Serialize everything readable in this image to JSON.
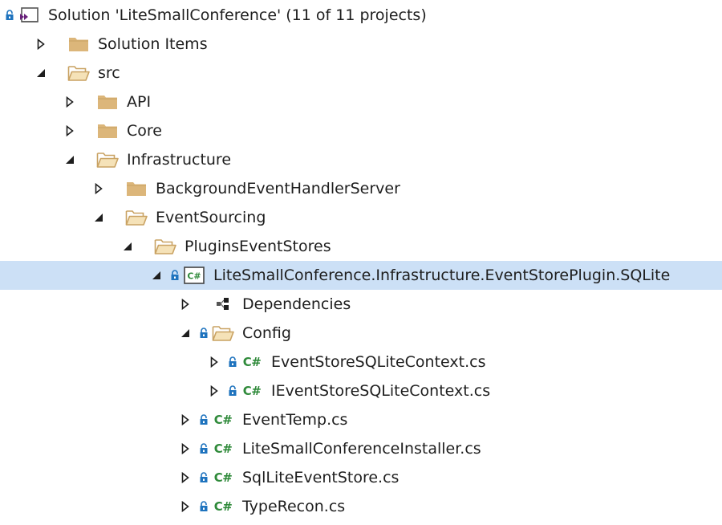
{
  "tree": [
    {
      "name": "solution-node",
      "label": "Solution 'LiteSmallConference' (11 of 11 projects)",
      "indent": 0,
      "expander": "none",
      "icon": "solution-icon",
      "lock": true
    },
    {
      "name": "folder-solution-items",
      "label": "Solution Items",
      "indent": 1,
      "expander": "collapsed",
      "icon": "folder-closed-icon",
      "lock": false
    },
    {
      "name": "folder-src",
      "label": "src",
      "indent": 1,
      "expander": "expanded",
      "icon": "folder-open-icon",
      "lock": false
    },
    {
      "name": "folder-api",
      "label": "API",
      "indent": 2,
      "expander": "collapsed",
      "icon": "folder-closed-icon",
      "lock": false
    },
    {
      "name": "folder-core",
      "label": "Core",
      "indent": 2,
      "expander": "collapsed",
      "icon": "folder-closed-icon",
      "lock": false
    },
    {
      "name": "folder-infrastructure",
      "label": "Infrastructure",
      "indent": 2,
      "expander": "expanded",
      "icon": "folder-open-icon",
      "lock": false
    },
    {
      "name": "folder-background-event-handler-server",
      "label": "BackgroundEventHandlerServer",
      "indent": 3,
      "expander": "collapsed",
      "icon": "folder-closed-icon",
      "lock": false
    },
    {
      "name": "folder-event-sourcing",
      "label": "EventSourcing",
      "indent": 3,
      "expander": "expanded",
      "icon": "folder-open-icon",
      "lock": false
    },
    {
      "name": "folder-plugins-event-stores",
      "label": "PluginsEventStores",
      "indent": 4,
      "expander": "expanded",
      "icon": "folder-open-icon",
      "lock": false
    },
    {
      "name": "project-event-store-plugin-sqlite",
      "label": "LiteSmallConference.Infrastructure.EventStorePlugin.SQLite",
      "indent": 5,
      "expander": "expanded",
      "icon": "csharp-project-icon",
      "lock": true,
      "selected": true
    },
    {
      "name": "node-dependencies",
      "label": "Dependencies",
      "indent": 6,
      "expander": "collapsed",
      "icon": "dependencies-icon",
      "lock": false
    },
    {
      "name": "folder-config",
      "label": "Config",
      "indent": 6,
      "expander": "expanded",
      "icon": "folder-open-icon",
      "lock": true
    },
    {
      "name": "file-event-store-sqlite-context",
      "label": "EventStoreSQLiteContext.cs",
      "indent": 7,
      "expander": "collapsed",
      "icon": "csharp-file-icon",
      "lock": true
    },
    {
      "name": "file-ievent-store-sqlite-context",
      "label": "IEventStoreSQLiteContext.cs",
      "indent": 7,
      "expander": "collapsed",
      "icon": "csharp-file-icon",
      "lock": true
    },
    {
      "name": "file-event-temp",
      "label": "EventTemp.cs",
      "indent": 6,
      "expander": "collapsed",
      "icon": "csharp-file-icon",
      "lock": true
    },
    {
      "name": "file-lite-small-conference-installer",
      "label": "LiteSmallConferenceInstaller.cs",
      "indent": 6,
      "expander": "collapsed",
      "icon": "csharp-file-icon",
      "lock": true
    },
    {
      "name": "file-sql-lite-event-store",
      "label": "SqlLiteEventStore.cs",
      "indent": 6,
      "expander": "collapsed",
      "icon": "csharp-file-icon",
      "lock": true
    },
    {
      "name": "file-type-recon",
      "label": "TypeRecon.cs",
      "indent": 6,
      "expander": "collapsed",
      "icon": "csharp-file-icon",
      "lock": true
    }
  ],
  "glyphs": {
    "csharp_file": "C#",
    "csharp_project": "C#"
  },
  "colors": {
    "selection": "#cce0f6",
    "folder": "#dcb67a",
    "csharp_green": "#2f8a3a",
    "lock_blue": "#1e73be",
    "solution_purple": "#68217a",
    "text": "#1e1e1e"
  }
}
